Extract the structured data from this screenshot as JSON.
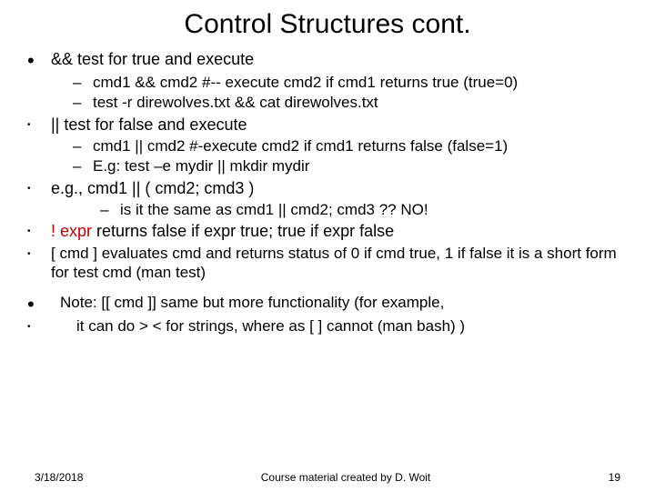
{
  "title": "Control Structures cont.",
  "b1": "&& test for true and execute",
  "b1s1": "cmd1 && cmd2   #-- execute cmd2 if cmd1 returns true (true=0)",
  "b1s2": "test -r direwolves.txt && cat direwolves.txt",
  "b2": "|| test for false and execute",
  "b2s1": "cmd1 || cmd2  #-execute cmd2 if cmd1 returns false (false=1)",
  "b2s2": "E.g:  test –e mydir || mkdir mydir",
  "b3": "e.g.,  cmd1 || ( cmd2; cmd3 )",
  "b3s1": "is it the same as  cmd1 || cmd2; cmd3 ?? ",
  "b3s1_no": "NO!",
  "b4_bang": "! expr",
  "b4_rest": " returns false if expr true; true if expr false",
  "b5": "[ cmd ] evaluates cmd and returns status of 0 if cmd true, 1 if false   it is a short form for test cmd (man test)",
  "b6": "Note:  [[ cmd ]]  same but  more functionality (for example,",
  "b7": "it can do > < for strings, where as  [ ] cannot (man bash) )",
  "footer_date": "3/18/2018",
  "footer_center": "Course material created by D. Woit",
  "footer_page": "19"
}
